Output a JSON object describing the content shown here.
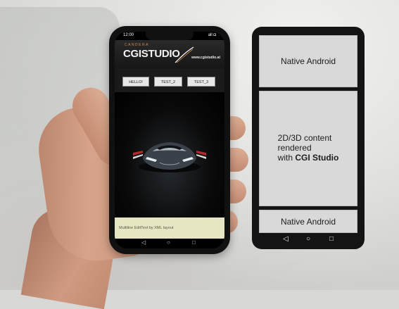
{
  "phone": {
    "status_time": "12:00",
    "status_right": "all ◘",
    "logo_top": "CANDERA",
    "logo_main": "CGISTUDIO",
    "url": "www.cgistudio.at",
    "buttons": [
      "HELLO!",
      "TEST_2",
      "TEST_3"
    ],
    "edittext_label": "Multiline EditText by XML layout",
    "nav_icons": [
      "back-icon",
      "home-icon",
      "recents-icon"
    ],
    "nav_glyphs": [
      "◁",
      "○",
      "□"
    ]
  },
  "mockup": {
    "top_label": "Native Android",
    "middle_line1": "2D/3D content",
    "middle_line2": "rendered",
    "middle_line3_prefix": "with ",
    "middle_line3_bold": "CGI Studio",
    "bottom_label": "Native Android",
    "nav_glyphs": [
      "◁",
      "○",
      "□"
    ]
  },
  "colors": {
    "logo_accent": "#d18a47",
    "edittext_bg": "#e6e7c2",
    "panel_bg": "#d9d9d9",
    "frame_dark": "#141414"
  }
}
